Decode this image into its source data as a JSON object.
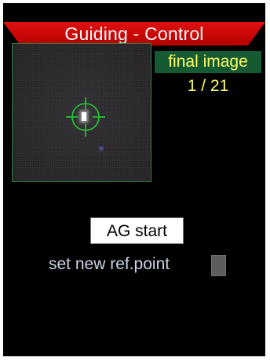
{
  "header": {
    "title": "Guiding - Control",
    "bar_color": "#d40000"
  },
  "preview": {
    "star_icon": "guide-star",
    "reticle_icon": "crosshair-circle",
    "reticle_color": "#22cc33",
    "border_color": "#2f7d3c"
  },
  "status": {
    "mode_label": "final image",
    "counter": "1 / 21",
    "text_color": "#ffff66",
    "mode_bg": "#155a33"
  },
  "controls": {
    "ag_start_label": "AG start",
    "ref_point_label": "set new ref.point"
  }
}
